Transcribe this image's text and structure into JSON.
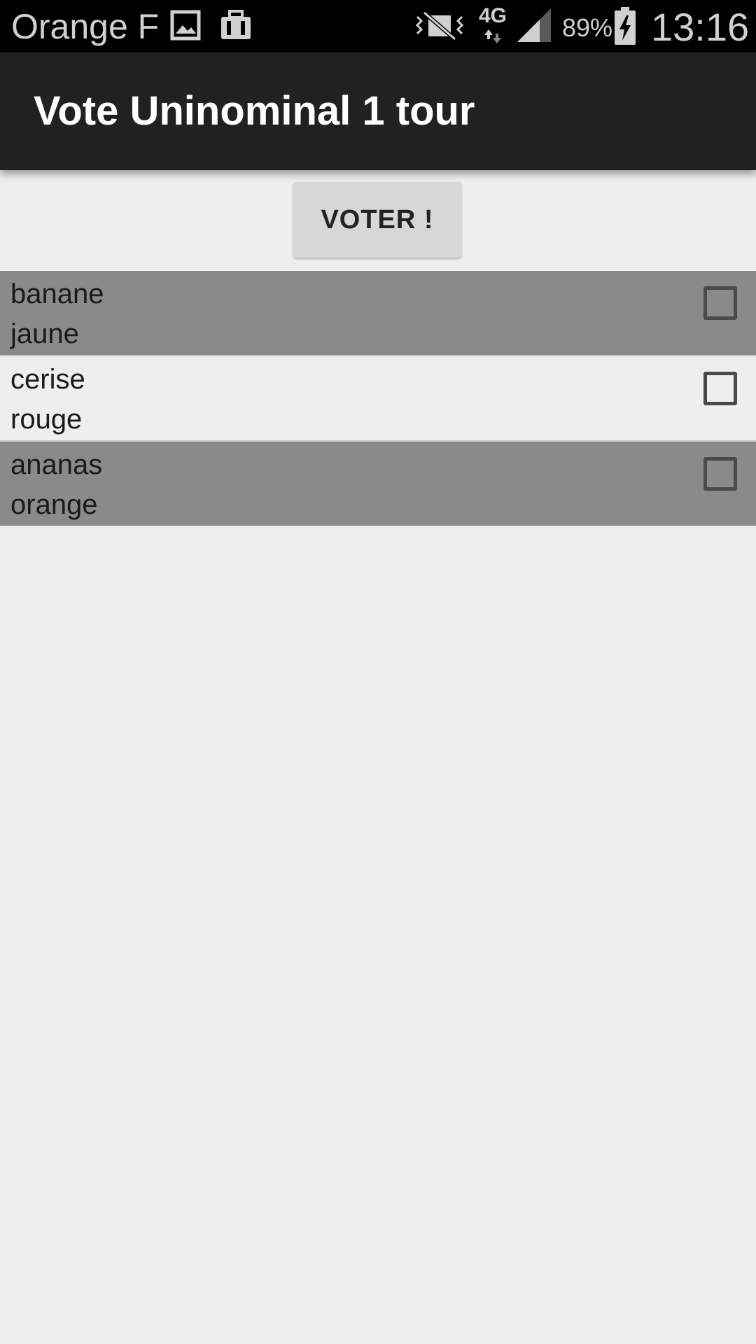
{
  "status_bar": {
    "carrier": "Orange F",
    "icons": [
      "image-icon",
      "briefcase-icon",
      "vibrate-icon",
      "network-4g-icon",
      "signal-icon",
      "battery-charging-icon"
    ],
    "network_label": "4G",
    "battery_percent": "89%",
    "time": "13:16"
  },
  "app_bar": {
    "title": "Vote Uninominal 1 tour"
  },
  "vote_button": {
    "label": "VOTER !"
  },
  "list": {
    "items": [
      {
        "name": "banane",
        "color": "jaune",
        "checked": false
      },
      {
        "name": "cerise",
        "color": "rouge",
        "checked": false
      },
      {
        "name": "ananas",
        "color": "orange",
        "checked": false
      }
    ]
  },
  "colors": {
    "status_bar_bg": "#000000",
    "app_bar_bg": "#212121",
    "screen_bg": "#eeeeee",
    "row_dark_bg": "#8a8a8a",
    "button_bg": "#d6d7d7"
  }
}
